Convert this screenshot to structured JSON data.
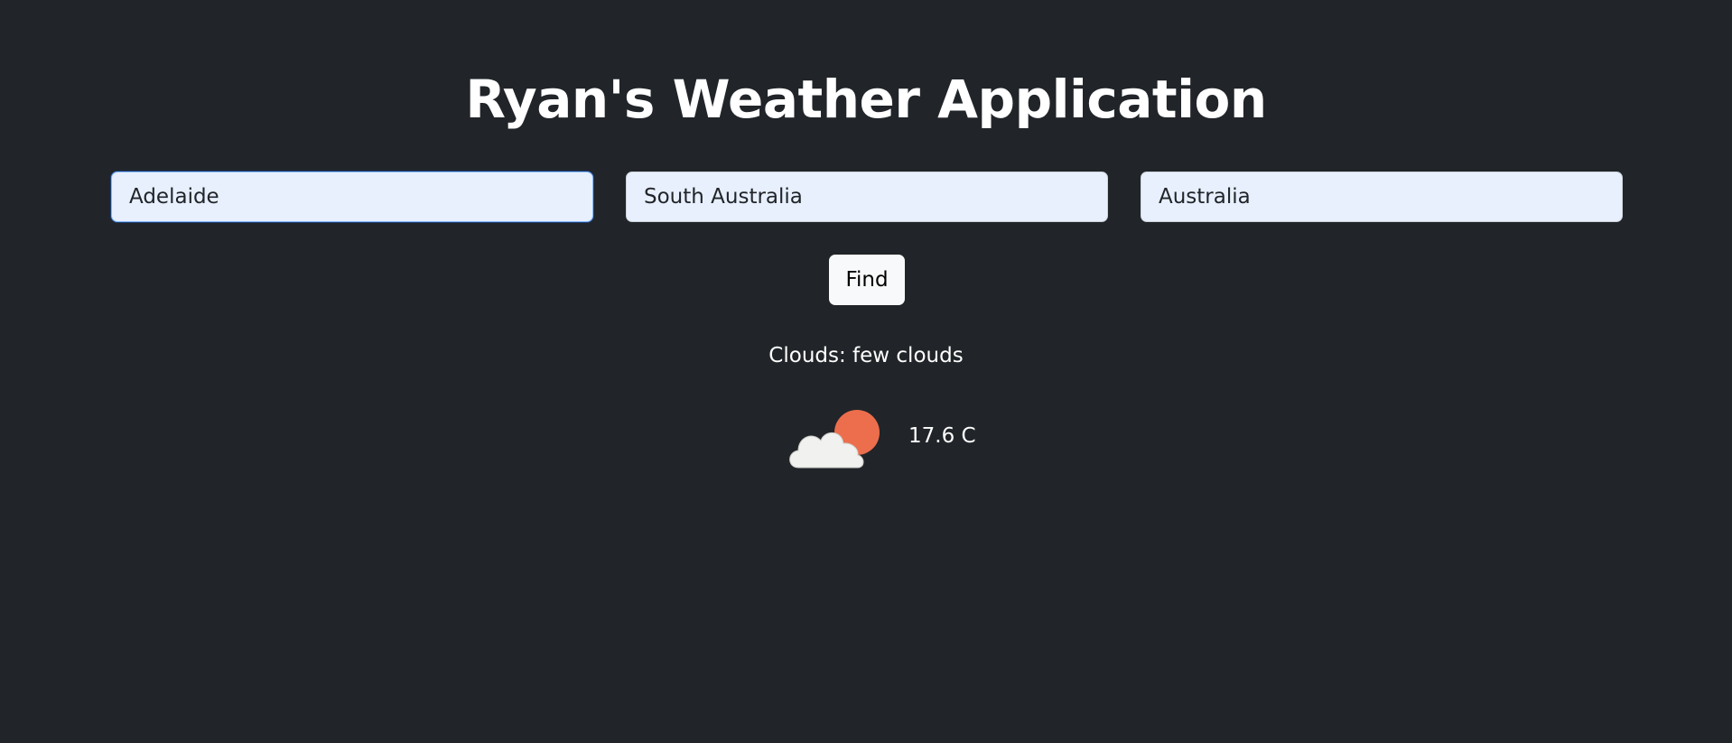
{
  "header": {
    "title": "Ryan's Weather Application"
  },
  "search": {
    "city": "Adelaide",
    "state": "South Australia",
    "country": "Australia",
    "find_label": "Find"
  },
  "result": {
    "conditions": "Clouds: few clouds",
    "temperature": "17.6 C",
    "icon": "few-clouds-day-icon"
  },
  "colors": {
    "background": "#212529",
    "input_background": "#e8f0fe",
    "button_background": "#f8f9fa",
    "sun": "#ec6e4c",
    "cloud": "#f1f1ef"
  }
}
